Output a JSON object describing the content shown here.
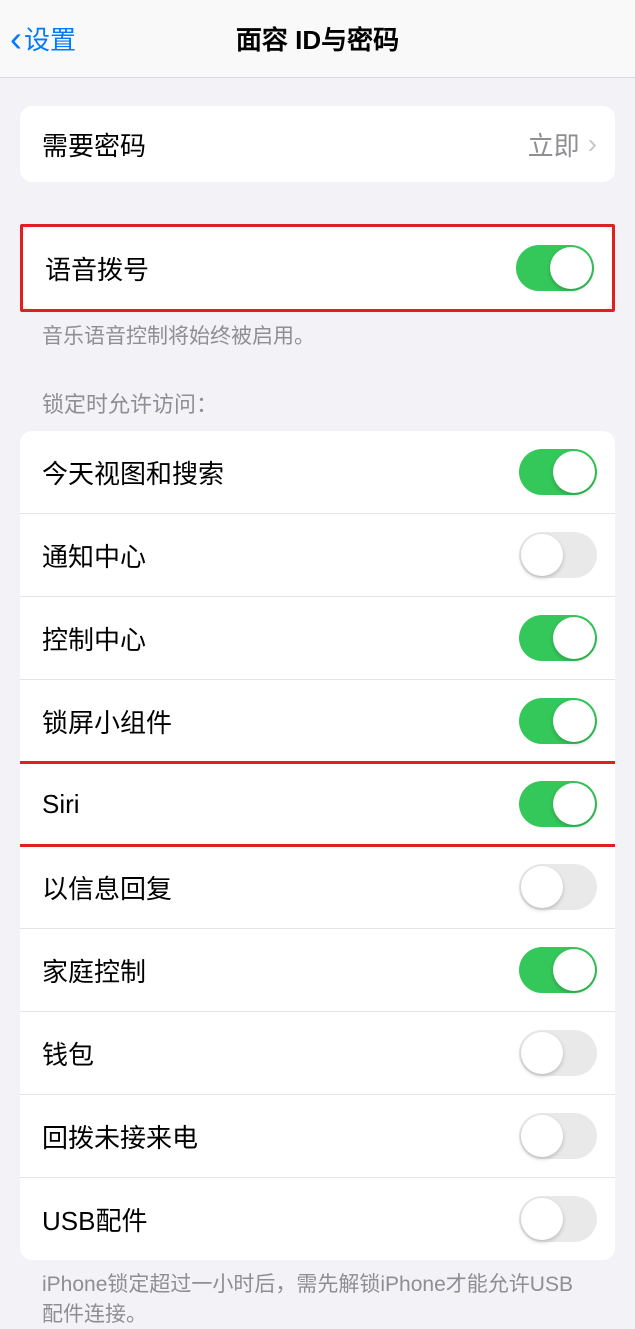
{
  "header": {
    "back_label": "设置",
    "title": "面容 ID与密码"
  },
  "require_passcode": {
    "label": "需要密码",
    "value": "立即"
  },
  "voice_dial": {
    "label": "语音拨号",
    "on": true
  },
  "voice_dial_footer": "音乐语音控制将始终被启用。",
  "lock_section_header": "锁定时允许访问：",
  "lock_items": [
    {
      "label": "今天视图和搜索",
      "on": true
    },
    {
      "label": "通知中心",
      "on": false
    },
    {
      "label": "控制中心",
      "on": true
    },
    {
      "label": "锁屏小组件",
      "on": true
    },
    {
      "label": "Siri",
      "on": true
    },
    {
      "label": "以信息回复",
      "on": false
    },
    {
      "label": "家庭控制",
      "on": true
    },
    {
      "label": "钱包",
      "on": false
    },
    {
      "label": "回拨未接来电",
      "on": false
    },
    {
      "label": "USB配件",
      "on": false
    }
  ],
  "usb_footer": "iPhone锁定超过一小时后，需先解锁iPhone才能允许USB配件连接。"
}
